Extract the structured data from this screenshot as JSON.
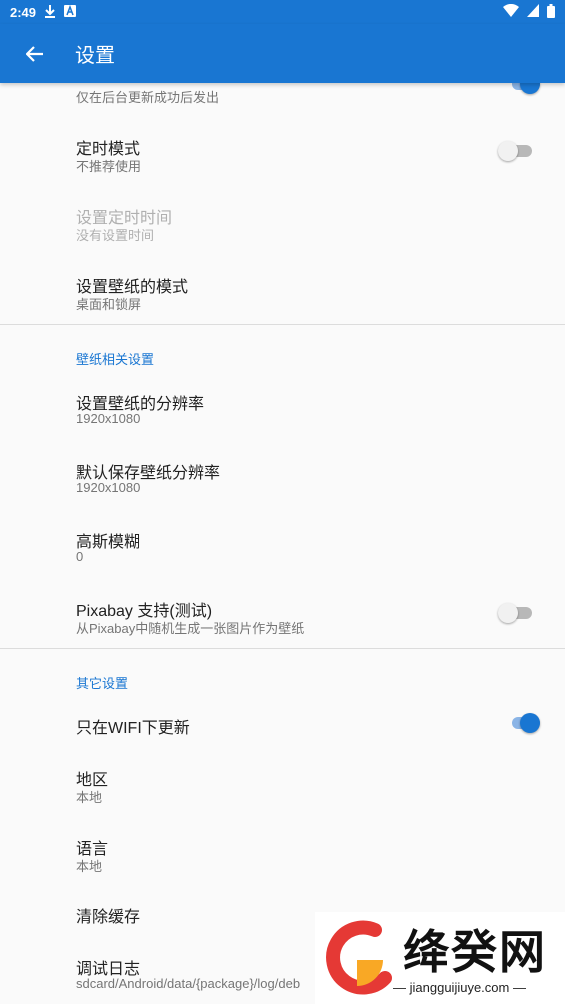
{
  "status": {
    "time": "2:49"
  },
  "appbar": {
    "title": "设置"
  },
  "items": {
    "notify": {
      "subtitle": "仅在后台更新成功后发出"
    },
    "timer": {
      "title": "定时模式",
      "subtitle": "不推荐使用"
    },
    "settime": {
      "title": "设置定时时间",
      "subtitle": "没有设置时间"
    },
    "mode": {
      "title": "设置壁纸的模式",
      "subtitle": "桌面和锁屏"
    },
    "resolution": {
      "title": "设置壁纸的分辨率",
      "subtitle": "1920x1080"
    },
    "saveres": {
      "title": "默认保存壁纸分辨率",
      "subtitle": "1920x1080"
    },
    "blur": {
      "title": "高斯模糊",
      "subtitle": "0"
    },
    "pixabay": {
      "title": "Pixabay 支持(测试)",
      "subtitle": "从Pixabay中随机生成一张图片作为壁纸"
    },
    "wifi": {
      "title": "只在WIFI下更新"
    },
    "region": {
      "title": "地区",
      "subtitle": "本地"
    },
    "language": {
      "title": "语言",
      "subtitle": "本地"
    },
    "cache": {
      "title": "清除缓存"
    },
    "log": {
      "title": "调试日志",
      "subtitle": "sdcard/Android/data/{package}/log/deb"
    }
  },
  "sections": {
    "wallpaper": "壁纸相关设置",
    "other": "其它设置"
  },
  "watermark": {
    "name": "绛癸网",
    "url": "jiangguijiuye.com"
  },
  "colors": {
    "primary": "#1976d2",
    "accent_on": "#1976d2"
  }
}
